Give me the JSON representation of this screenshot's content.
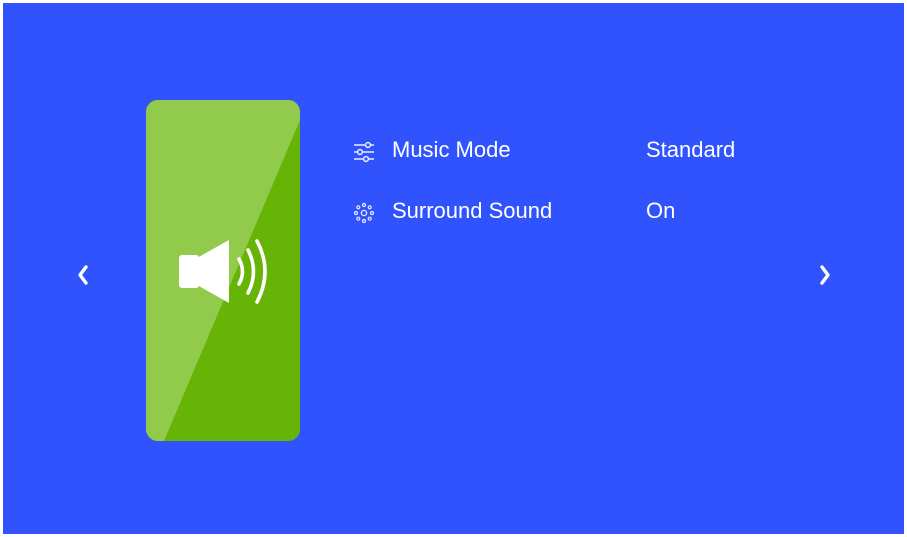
{
  "colors": {
    "background": "#3053fd",
    "card_light": "#92ca4b",
    "card_dark": "#66b405",
    "text": "#ffffff"
  },
  "navigation": {
    "prev_icon": "chevron-left-icon",
    "next_icon": "chevron-right-icon"
  },
  "card": {
    "icon": "speaker-volume-icon"
  },
  "settings": [
    {
      "icon": "equalizer-sliders-icon",
      "label": "Music Mode",
      "value": "Standard"
    },
    {
      "icon": "surround-sound-icon",
      "label": "Surround Sound",
      "value": "On"
    }
  ]
}
